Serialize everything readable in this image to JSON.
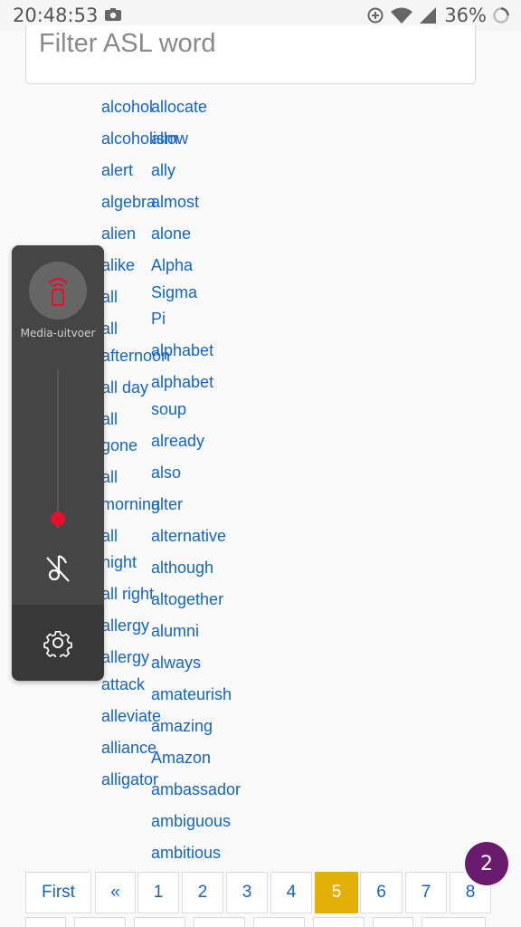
{
  "status_bar": {
    "time": "20:48:53",
    "battery_percent": "36%"
  },
  "filter": {
    "placeholder": "Filter ASL word"
  },
  "words": {
    "column_a": [
      "alcohol",
      "alcoholism",
      "alert",
      "algebra",
      "alien",
      "alike",
      "all",
      "all afternoon",
      "all day",
      "all gone",
      "all morning",
      "all night",
      "all right",
      "allergy",
      "allergy attack",
      "alleviate",
      "alliance",
      "alligator"
    ],
    "column_b": [
      "allocate",
      "allow",
      "ally",
      "almost",
      "alone",
      "Alpha Sigma Pi",
      "alphabet",
      "alphabet soup",
      "already",
      "also",
      "alter",
      "alternative",
      "although",
      "altogether",
      "alumni",
      "always",
      "amateurish",
      "amazing",
      "Amazon",
      "ambassador",
      "ambiguous",
      "ambitious"
    ]
  },
  "media_panel": {
    "label": "Media-uitvoer",
    "volume_level": 0.06
  },
  "pagination": {
    "first": "First",
    "prev": "«",
    "pages": [
      "1",
      "2",
      "3",
      "4",
      "5",
      "6",
      "7",
      "8"
    ],
    "active": "5"
  },
  "badge": {
    "count": "2"
  },
  "colors": {
    "link": "#1565c0",
    "active_page": "#e2b007",
    "badge": "#6a1b6e",
    "cast_icon": "#e5102e"
  }
}
